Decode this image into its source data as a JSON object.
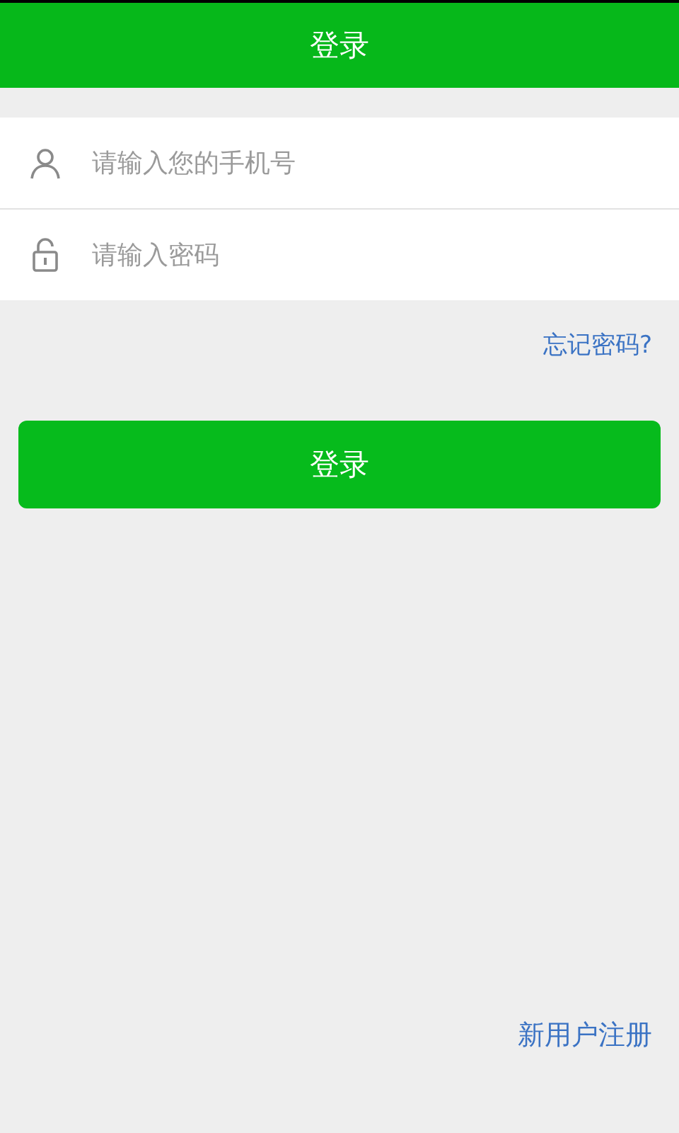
{
  "header": {
    "title": "登录"
  },
  "fields": [
    {
      "kind": "phone",
      "placeholder": "请输入您的手机号"
    },
    {
      "kind": "password",
      "placeholder": "请输入密码"
    }
  ],
  "forgot_link": "忘记密码?",
  "login_button": "登录",
  "register_link": "新用户注册"
}
